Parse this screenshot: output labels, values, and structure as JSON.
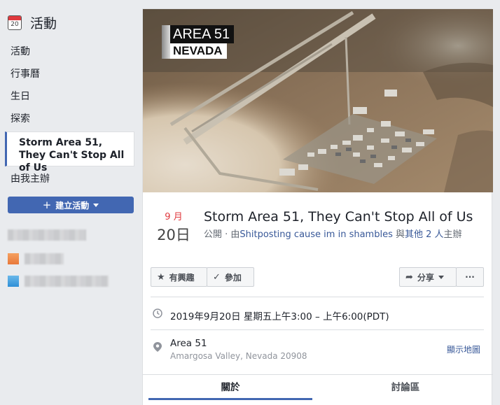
{
  "sidebar": {
    "title": "活動",
    "calendar_day": "20",
    "items": [
      {
        "label": "活動"
      },
      {
        "label": "行事曆"
      },
      {
        "label": "生日"
      },
      {
        "label": "探索"
      },
      {
        "label": "Storm Area 51, They Can't Stop All of Us"
      },
      {
        "label": "由我主辦"
      }
    ],
    "create_button": "建立活動",
    "colors": {
      "accent": "#4267b2",
      "icon_orange": "#f0874f",
      "icon_blue": "#3b9cdb"
    }
  },
  "cover": {
    "label_line1": "AREA 51",
    "label_line2": "NEVADA"
  },
  "event": {
    "month": "9 月",
    "day": "20日",
    "title": "Storm Area 51, They Can't Stop All of Us",
    "meta_prefix": "公開 · 由",
    "host": "Shitposting cause im in shambles",
    "meta_mid": " 與",
    "others": "其他 2 人",
    "meta_suffix": "主辦"
  },
  "actions": {
    "interested": "有興趣",
    "going": "參加",
    "share": "分享",
    "more": "···"
  },
  "details": {
    "datetime": "2019年9月20日 星期五上午3:00 – 上午6:00(PDT)",
    "location_name": "Area 51",
    "location_address": "Amargosa Valley, Nevada 20908",
    "map_link": "顯示地圖"
  },
  "tabs": [
    {
      "label": "關於"
    },
    {
      "label": "討論區"
    }
  ]
}
